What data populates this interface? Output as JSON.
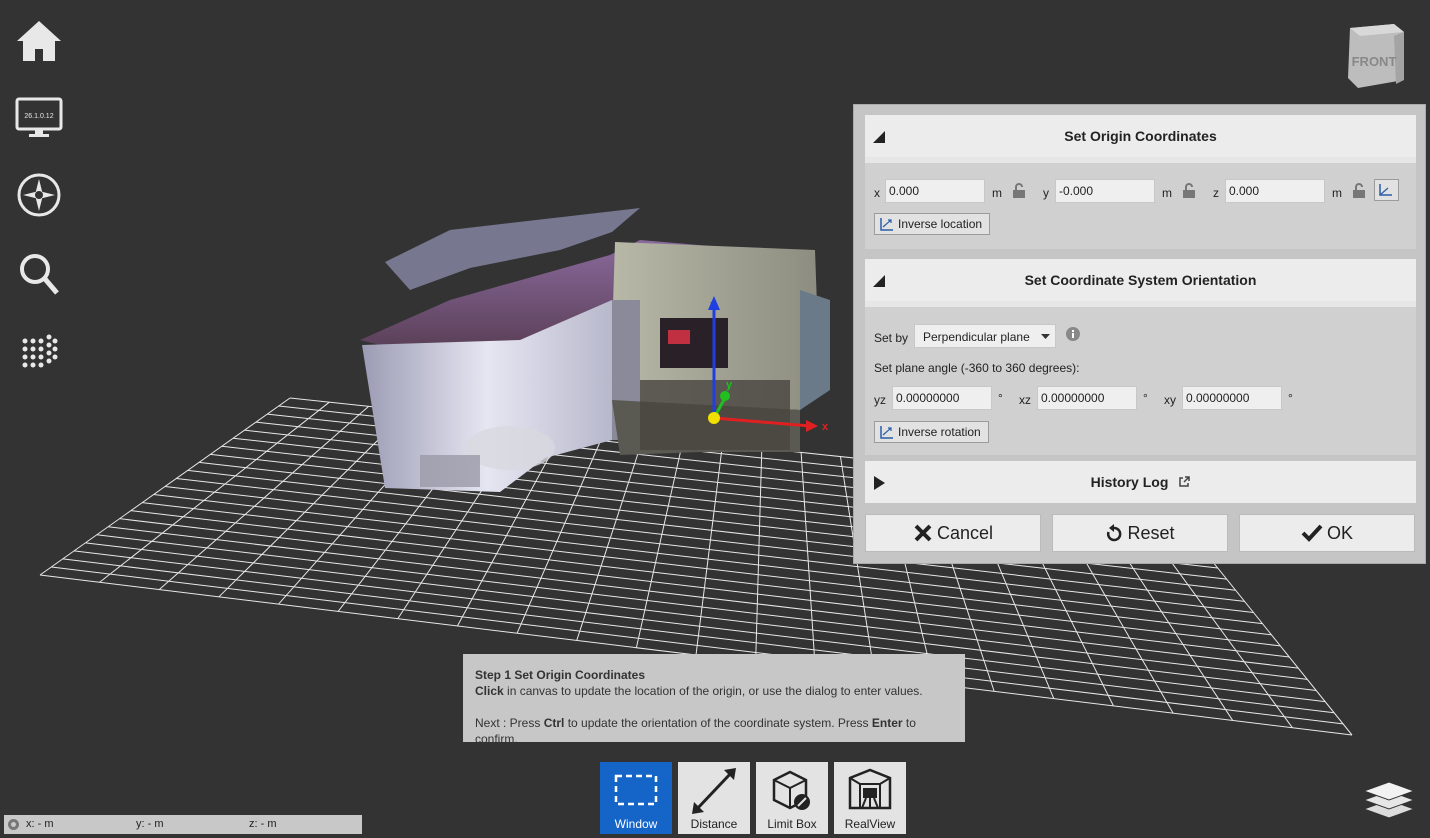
{
  "left_toolbar": {
    "items": [
      "home-icon",
      "monitor-icon",
      "compass-icon",
      "search-icon",
      "point-grid-icon"
    ],
    "monitor_text": "26.1.0.12"
  },
  "nav_cube": {
    "face_label": "FRONT"
  },
  "viewport": {
    "axes": {
      "x": "x",
      "y": "y",
      "z": "z"
    },
    "colors": {
      "x_axis": "#e02020",
      "y_axis": "#20c020",
      "z_axis": "#1f3fe0",
      "origin": "#f0e000"
    }
  },
  "dialog": {
    "origin": {
      "title": "Set Origin Coordinates",
      "x_label": "x",
      "x_value": "0.000",
      "x_unit": "m",
      "y_label": "y",
      "y_value": "-0.000",
      "y_unit": "m",
      "z_label": "z",
      "z_value": "0.000",
      "z_unit": "m",
      "inverse_location": "Inverse location"
    },
    "orientation": {
      "title": "Set Coordinate System Orientation",
      "set_by_label": "Set by",
      "set_by_value": "Perpendicular plane",
      "angle_label": "Set plane angle (-360 to 360 degrees):",
      "yz_label": "yz",
      "yz_value": "0.00000000",
      "xz_label": "xz",
      "xz_value": "0.00000000",
      "xy_label": "xy",
      "xy_value": "0.00000000",
      "degree": "°",
      "inverse_rotation": "Inverse rotation"
    },
    "history": {
      "title": "History Log"
    },
    "buttons": {
      "cancel": "Cancel",
      "reset": "Reset",
      "ok": "OK"
    }
  },
  "hint": {
    "title": "Step 1 Set Origin Coordinates",
    "line1_bold": "Click",
    "line1_rest": " in canvas to update the location of the origin, or use the dialog to enter values.",
    "line2_a": "Next : Press ",
    "line2_ctrl": "Ctrl",
    "line2_b": " to update the orientation of the coordinate system. Press ",
    "line2_enter": "Enter",
    "line2_c": " to confirm."
  },
  "bottom_tools": [
    {
      "label": "Window",
      "active": true
    },
    {
      "label": "Distance",
      "active": false
    },
    {
      "label": "Limit Box",
      "active": false
    },
    {
      "label": "RealView",
      "active": false
    }
  ],
  "status_bar": {
    "x": "x:  - m",
    "y": "y:  - m",
    "z": "z:  - m"
  },
  "accent": "#1565c9"
}
